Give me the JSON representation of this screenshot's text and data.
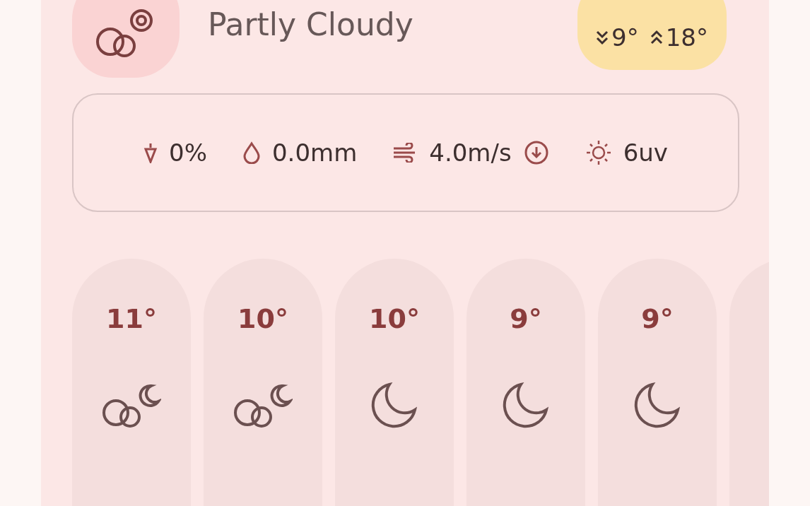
{
  "current": {
    "condition": "Partly Cloudy",
    "low": "9°",
    "high": "18°"
  },
  "stats": [
    {
      "kind": "precip-chance",
      "value": "0%"
    },
    {
      "kind": "precip-amount",
      "value": "0.0mm"
    },
    {
      "kind": "wind",
      "value": "4.0m/s"
    },
    {
      "kind": "uv",
      "value": "6uv"
    }
  ],
  "hourly": [
    {
      "temp": "11°",
      "kind": "cloud-moon"
    },
    {
      "temp": "10°",
      "kind": "cloud-moon"
    },
    {
      "temp": "10°",
      "kind": "moon"
    },
    {
      "temp": "9°",
      "kind": "moon"
    },
    {
      "temp": "9°",
      "kind": "moon"
    },
    {
      "kind": "partial"
    }
  ]
}
